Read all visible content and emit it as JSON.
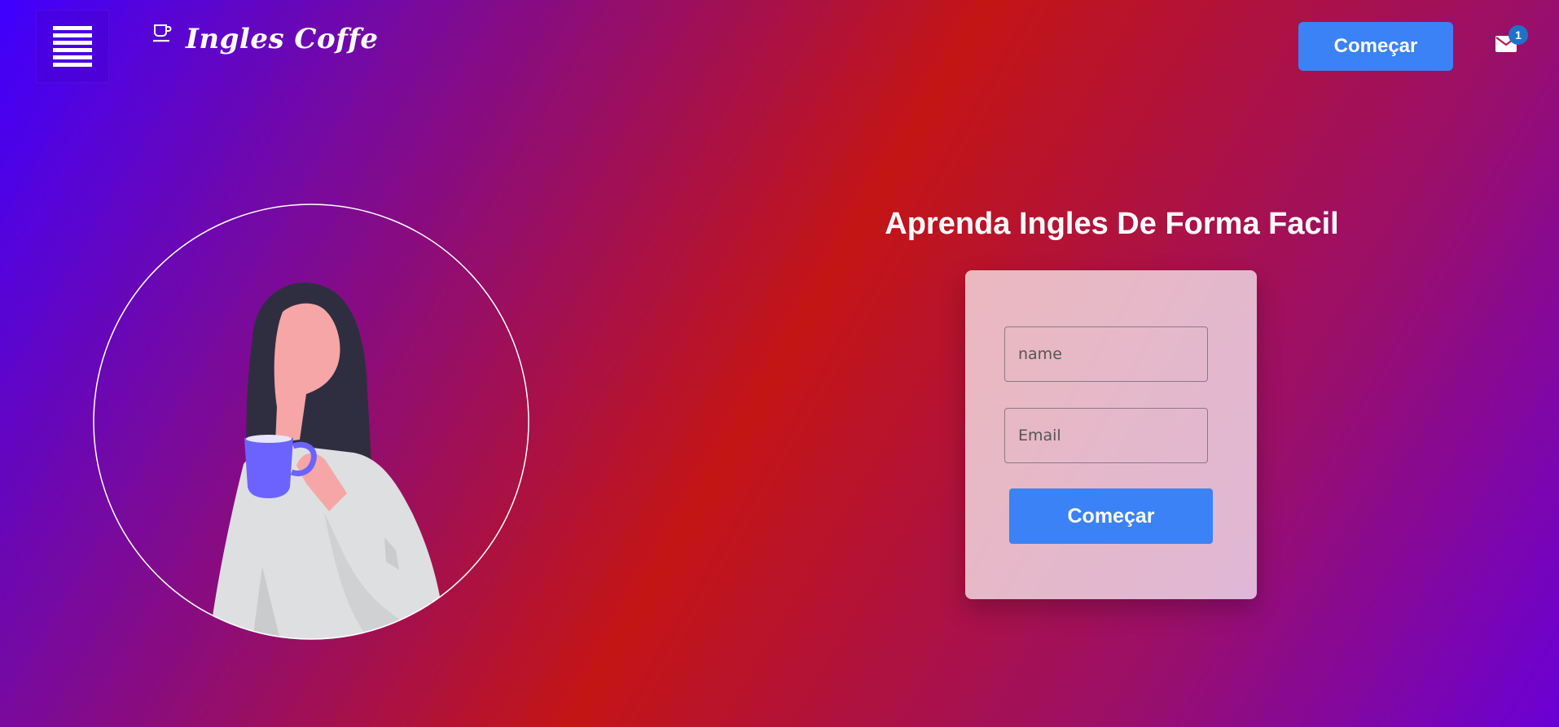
{
  "header": {
    "brand_name": "Ingles Coffe",
    "cta_label": "Começar",
    "notification_count": "1"
  },
  "hero": {
    "headline": "Aprenda Ingles De Forma Facil"
  },
  "form": {
    "name_placeholder": "name",
    "email_placeholder": "Email",
    "submit_label": "Começar"
  },
  "icons": {
    "menu": "hamburger-menu-icon",
    "brand": "coffee-cup-icon",
    "mail": "envelope-icon"
  },
  "colors": {
    "accent": "#3b82f6",
    "badge": "#1e73c8",
    "gradient_start": "#3f00ff",
    "gradient_mid": "#c41515",
    "gradient_end": "#6a00d6"
  }
}
